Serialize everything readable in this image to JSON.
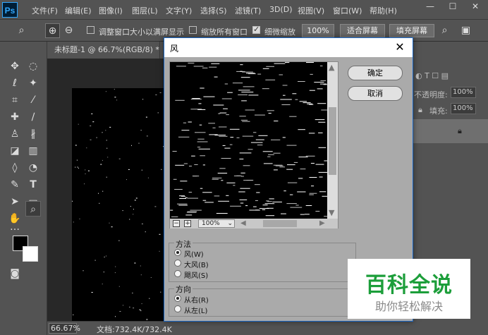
{
  "app": {
    "logo": "Ps"
  },
  "menu": [
    "文件(F)",
    "编辑(E)",
    "图像(I)",
    "图层(L)",
    "文字(Y)",
    "选择(S)",
    "滤镜(T)",
    "3D(D)",
    "视图(V)",
    "窗口(W)",
    "帮助(H)"
  ],
  "window_controls": {
    "minimize": "—",
    "maximize": "☐",
    "close": "✕"
  },
  "options": {
    "resize_windows_label": "调整窗口大小以满屏显示",
    "resize_windows_checked": false,
    "zoom_all_label": "缩放所有窗口",
    "zoom_all_checked": false,
    "scrubby_label": "细微缩放",
    "scrubby_checked": true,
    "btn_100": "100%",
    "btn_fit": "适合屏幕",
    "btn_fill": "填充屏幕"
  },
  "document": {
    "tab_title": "未标题-1 @ 66.7%(RGB/8) *",
    "tab_close": "×",
    "zoom": "66.67%",
    "info": "文档:732.4K/732.4K"
  },
  "right_panel": {
    "opacity_label": "不透明度:",
    "opacity_value": "100%",
    "fill_label": "填充:",
    "fill_value": "100%"
  },
  "dialog": {
    "title": "风",
    "close": "✕",
    "ok": "确定",
    "cancel": "取消",
    "zoom_value": "100%",
    "zoom_minus": "−",
    "zoom_plus": "+",
    "method": {
      "title": "方法",
      "options": [
        {
          "label": "风(W)",
          "selected": true
        },
        {
          "label": "大风(B)",
          "selected": false
        },
        {
          "label": "飓风(S)",
          "selected": false
        }
      ]
    },
    "direction": {
      "title": "方向",
      "options": [
        {
          "label": "从右(R)",
          "selected": true
        },
        {
          "label": "从左(L)",
          "selected": false
        }
      ]
    }
  },
  "watermark": {
    "title": "百科全说",
    "subtitle": "助你轻松解决"
  }
}
